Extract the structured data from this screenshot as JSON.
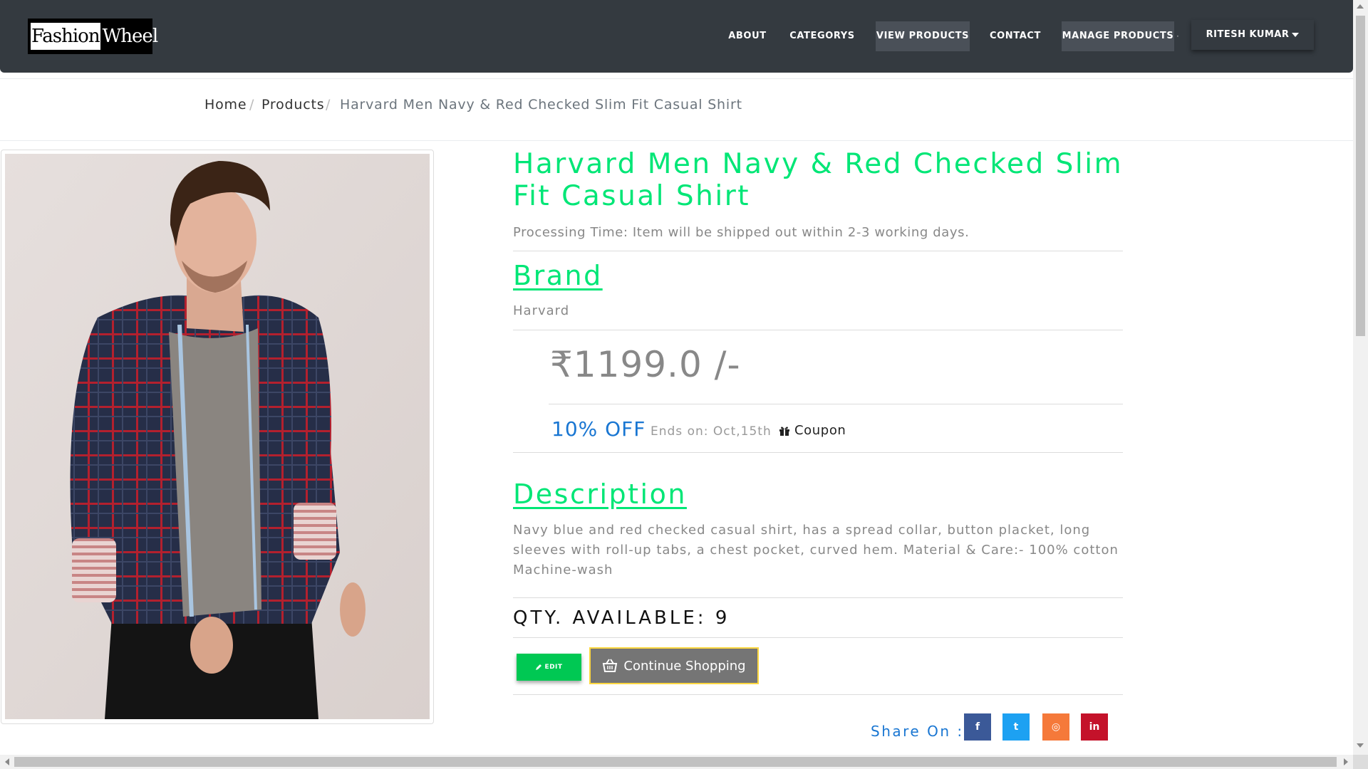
{
  "navbar": {
    "logo_part1": "Fashion",
    "logo_part2": "Wheel",
    "items": [
      {
        "label": "ABOUT"
      },
      {
        "label": "CATEGORYS"
      },
      {
        "label": "VIEW PRODUCTS"
      },
      {
        "label": "CONTACT"
      },
      {
        "label": "MANAGE PRODUCTS"
      }
    ],
    "separator": "·",
    "user": "RITESH KUMAR"
  },
  "breadcrumb": {
    "home": "Home",
    "products": "Products",
    "current": "Harvard Men Navy & Red Checked Slim Fit Casual Shirt",
    "separator": "/"
  },
  "product": {
    "title": "Harvard Men Navy & Red Checked Slim Fit Casual Shirt",
    "processing": "Processing Time: Item will be shipped out within 2-3 working days.",
    "brand_heading": "Brand",
    "brand": "Harvard",
    "price": "₹1199.0 /-",
    "discount": "10% OFF",
    "ends_on": "Ends on: Oct,15th",
    "coupon_label": "Coupon",
    "description_heading": "Description",
    "description": "Navy blue and red checked casual shirt, has a spread collar, button placket, long sleeves with roll-up tabs, a chest pocket, curved hem. Material & Care:- 100% cotton Machine-wash",
    "qty_text": "QTY. AVAILABLE: 9"
  },
  "actions": {
    "edit_label": "EDIT",
    "continue_label": "Continue Shopping"
  },
  "share": {
    "label": "Share On :",
    "networks": [
      {
        "icon": "facebook-icon",
        "glyph": "f",
        "color": "#3b5998"
      },
      {
        "icon": "twitter-icon",
        "glyph": "t",
        "color": "#1da1f2"
      },
      {
        "icon": "instagram-icon",
        "glyph": "◎",
        "color": "#f5793a"
      },
      {
        "icon": "linkedin-icon",
        "glyph": "in",
        "color": "#c4122a"
      }
    ]
  },
  "colors": {
    "accent_green": "#00e676",
    "navbar_bg": "#343a40",
    "link_blue": "#1976d2",
    "edit_button": "#00c853",
    "continue_button": "#757575"
  }
}
